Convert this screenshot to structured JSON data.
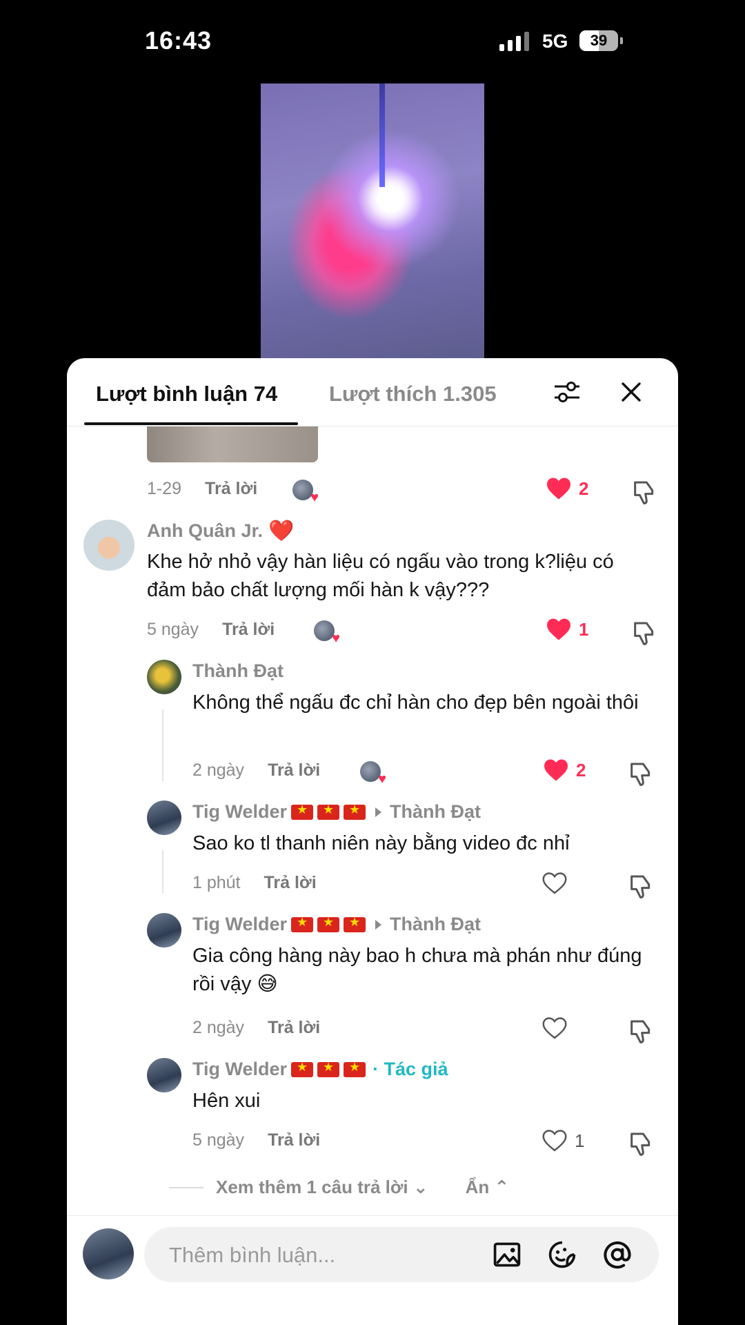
{
  "status_bar": {
    "time": "16:43",
    "network": "5G",
    "battery": "39"
  },
  "sheet": {
    "tab_comments": "Lượt bình luận 74",
    "tab_likes": "Lượt thích 1.305"
  },
  "comments": [
    {
      "date": "1-29",
      "reply": "Trả lời",
      "likes": "2"
    },
    {
      "author": "Anh Quân Jr.",
      "text": "Khe hở nhỏ vậy hàn liệu có ngấu vào trong k?liệu có đảm bảo chất lượng mối hàn k vậy???",
      "date": "5 ngày",
      "reply": "Trả lời",
      "likes": "1"
    },
    {
      "author": "Thành Đạt",
      "text": "Không thể ngấu đc chỉ hàn cho đẹp bên ngoài thôi",
      "date": "2 ngày",
      "reply": "Trả lời",
      "likes": "2"
    },
    {
      "author": "Tig Welder",
      "reply_to": "Thành Đạt",
      "text": "Sao ko tl thanh niên này bằng video đc nhỉ",
      "date": "1 phút",
      "reply": "Trả lời"
    },
    {
      "author": "Tig Welder",
      "reply_to": "Thành Đạt",
      "text": "Gia công hàng này bao h chưa mà phán như đúng rồi vậy 😅",
      "date": "2 ngày",
      "reply": "Trả lời"
    },
    {
      "author": "Tig Welder",
      "author_tag": "· Tác giả",
      "text": "Hên xui",
      "date": "5 ngày",
      "reply": "Trả lời",
      "likes": "1"
    }
  ],
  "more_replies": "Xem thêm 1 câu trả lời",
  "hide": "Ẩn",
  "composer": {
    "placeholder": "Thêm bình luận..."
  },
  "colors": {
    "like": "#fe2c55",
    "author_tag": "#20b8c6"
  },
  "icons": [
    "filter-icon",
    "close-icon",
    "heart-icon",
    "dislike-icon",
    "image-icon",
    "emoji-icon",
    "mention-icon",
    "chevron-down-icon",
    "chevron-up-icon"
  ]
}
